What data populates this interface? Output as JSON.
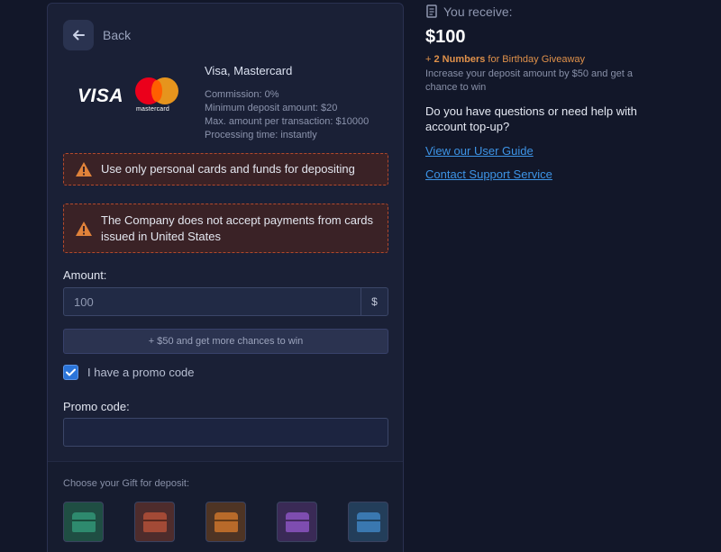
{
  "nav": {
    "back_label": "Back",
    "back_icon": "arrow-left-icon"
  },
  "payment_method": {
    "title": "Visa, Mastercard",
    "brands": [
      "VISA",
      "mastercard"
    ],
    "details": [
      "Commission: 0%",
      "Minimum deposit amount: $20",
      "Max. amount per transaction: $10000",
      "Processing time: instantly"
    ]
  },
  "warnings": [
    {
      "icon": "warning-icon",
      "text": "Use only personal cards and funds for depositing"
    },
    {
      "icon": "warning-icon",
      "text": "The Company does not accept payments from cards issued in United States"
    }
  ],
  "amount": {
    "label": "Amount:",
    "value": "100",
    "unit": "$"
  },
  "bonus_button": {
    "label": "+ $50 and get more chances to win"
  },
  "promo": {
    "checkbox_label": "I have a promo code",
    "checked": true,
    "field_label": "Promo code:",
    "value": ""
  },
  "gifts": {
    "title": "Choose your Gift for deposit:",
    "items": [
      {
        "name": "green-gift-chest-icon",
        "color": "#2e8a6e"
      },
      {
        "name": "red-gift-chest-icon",
        "color": "#a34a36"
      },
      {
        "name": "orange-gift-chest-icon",
        "color": "#b86a2a"
      },
      {
        "name": "purple-gift-chest-icon",
        "color": "#7e4db0"
      },
      {
        "name": "blue-gift-chest-icon",
        "color": "#3a78b0"
      }
    ]
  },
  "summary": {
    "receive_icon": "receipt-icon",
    "receive_label": "You receive:",
    "amount": "$100",
    "giveaway_prefix": "+ ",
    "giveaway_bold": "2 Numbers",
    "giveaway_rest": " for Birthday Giveaway",
    "giveaway_note": "Increase your deposit amount by $50 and get a chance to win",
    "question": "Do you have questions or need help with account top-up?",
    "links": [
      "View our User Guide",
      "Contact Support Service"
    ]
  },
  "colors": {
    "background": "#121729",
    "panel": "#1a2036",
    "accent": "#3d94e6",
    "warning_border": "#b3492c",
    "giveaway": "#e0914a"
  }
}
